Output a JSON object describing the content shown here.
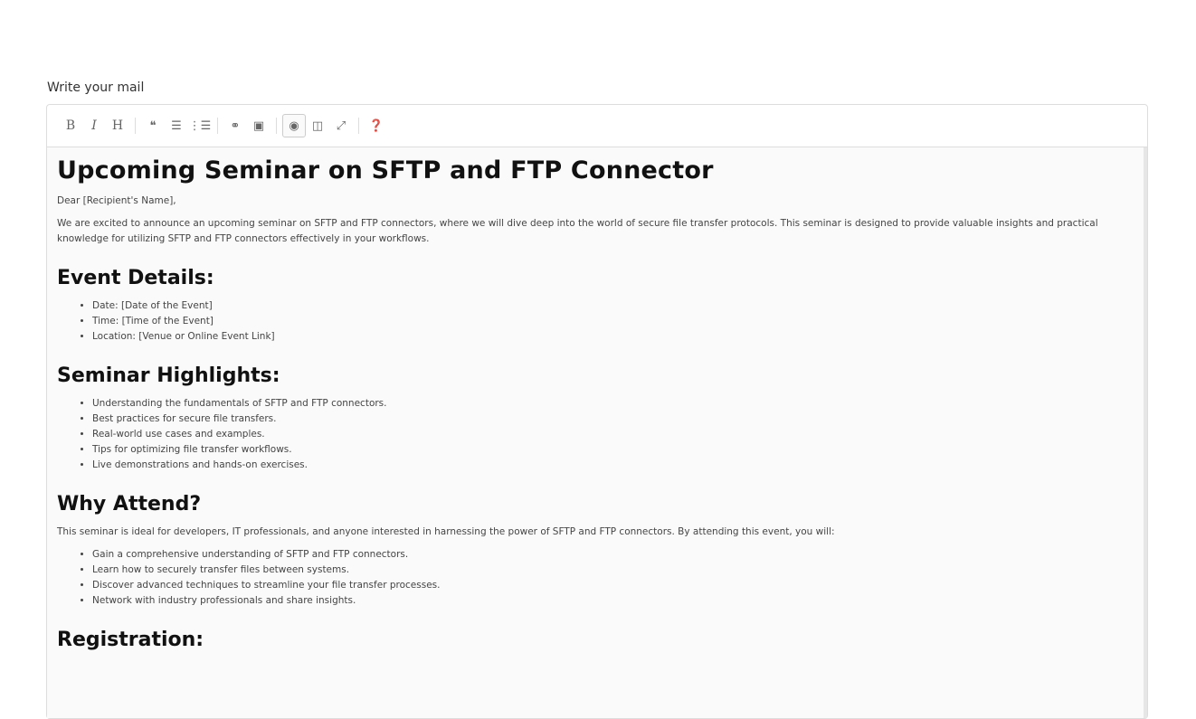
{
  "form": {
    "label": "Write your mail"
  },
  "toolbar": {
    "groups": [
      [
        {
          "name": "bold-button",
          "glyph": "B",
          "serif": true
        },
        {
          "name": "italic-button",
          "glyph": "I",
          "serif": true,
          "italic": true
        },
        {
          "name": "heading-button",
          "glyph": "H",
          "serif": true
        }
      ],
      [
        {
          "name": "quote-button",
          "glyph": "❝"
        },
        {
          "name": "unordered-list-button",
          "glyph": "☰"
        },
        {
          "name": "ordered-list-button",
          "glyph": "⋮☰"
        }
      ],
      [
        {
          "name": "link-button",
          "glyph": "⚭"
        },
        {
          "name": "image-button",
          "glyph": "▣"
        }
      ],
      [
        {
          "name": "preview-button",
          "glyph": "◉",
          "active": true
        },
        {
          "name": "side-by-side-button",
          "glyph": "◫"
        },
        {
          "name": "fullscreen-button",
          "glyph": "⤢"
        }
      ],
      [
        {
          "name": "help-button",
          "glyph": "❓"
        }
      ]
    ]
  },
  "content": {
    "title": "Upcoming Seminar on SFTP and FTP Connector",
    "greeting": "Dear [Recipient's Name],",
    "intro": "We are excited to announce an upcoming seminar on SFTP and FTP connectors, where we will dive deep into the world of secure file transfer protocols. This seminar is designed to provide valuable insights and practical knowledge for utilizing SFTP and FTP connectors effectively in your workflows.",
    "event_heading": "Event Details:",
    "event_items": [
      "Date: [Date of the Event]",
      "Time: [Time of the Event]",
      "Location: [Venue or Online Event Link]"
    ],
    "highlights_heading": "Seminar Highlights:",
    "highlights_items": [
      "Understanding the fundamentals of SFTP and FTP connectors.",
      "Best practices for secure file transfers.",
      "Real-world use cases and examples.",
      "Tips for optimizing file transfer workflows.",
      "Live demonstrations and hands-on exercises."
    ],
    "why_heading": "Why Attend?",
    "why_text": "This seminar is ideal for developers, IT professionals, and anyone interested in harnessing the power of SFTP and FTP connectors. By attending this event, you will:",
    "why_items": [
      "Gain a comprehensive understanding of SFTP and FTP connectors.",
      "Learn how to securely transfer files between systems.",
      "Discover advanced techniques to streamline your file transfer processes.",
      "Network with industry professionals and share insights."
    ],
    "registration_heading": "Registration:"
  }
}
